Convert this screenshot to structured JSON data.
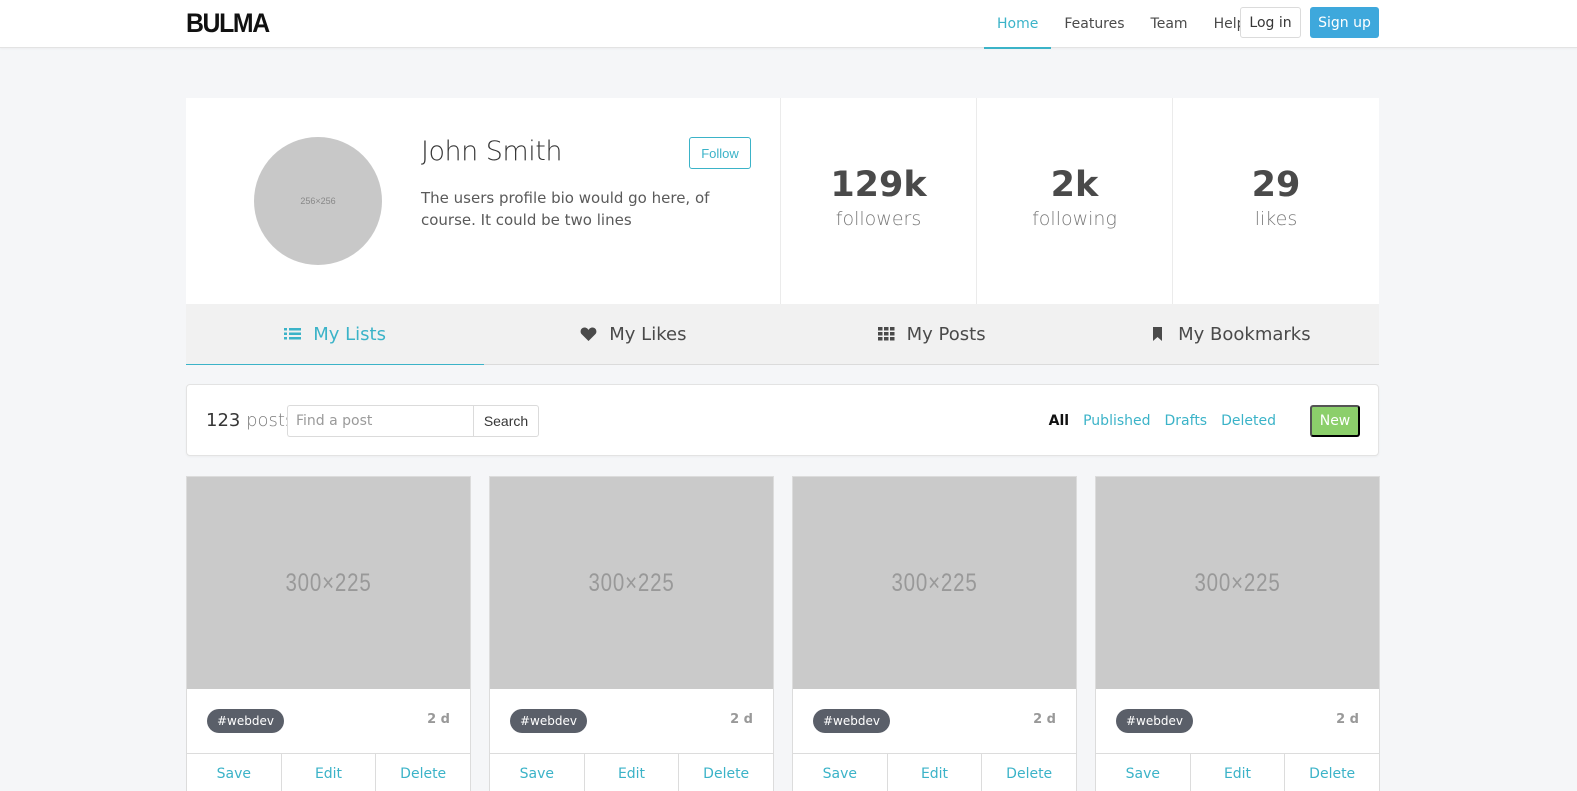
{
  "navbar": {
    "logo": "BULMA",
    "links": [
      "Home",
      "Features",
      "Team",
      "Help"
    ],
    "active_link": "Home",
    "login_label": "Log in",
    "signup_label": "Sign up"
  },
  "profile": {
    "avatar_placeholder": "256×256",
    "name": "John Smith",
    "follow_label": "Follow",
    "bio": "The users profile bio would go here, of course. It could be two lines",
    "stats": [
      {
        "value": "129k",
        "label": "followers"
      },
      {
        "value": "2k",
        "label": "following"
      },
      {
        "value": "29",
        "label": "likes"
      }
    ]
  },
  "tabs": [
    {
      "label": "My Lists",
      "icon": "list-icon",
      "active": true
    },
    {
      "label": "My Likes",
      "icon": "heart-icon",
      "active": false
    },
    {
      "label": "My Posts",
      "icon": "grid-icon",
      "active": false
    },
    {
      "label": "My Bookmarks",
      "icon": "bookmark-icon",
      "active": false
    }
  ],
  "toolbar": {
    "count": "123",
    "count_label": "posts",
    "search_placeholder": "Find a post",
    "search_label": "Search",
    "filters": [
      "All",
      "Published",
      "Drafts",
      "Deleted"
    ],
    "active_filter": "All",
    "new_label": "New"
  },
  "cards": [
    {
      "image": "300×225",
      "tag": "#webdev",
      "age": "2 d",
      "actions": [
        "Save",
        "Edit",
        "Delete"
      ]
    },
    {
      "image": "300×225",
      "tag": "#webdev",
      "age": "2 d",
      "actions": [
        "Save",
        "Edit",
        "Delete"
      ]
    },
    {
      "image": "300×225",
      "tag": "#webdev",
      "age": "2 d",
      "actions": [
        "Save",
        "Edit",
        "Delete"
      ]
    },
    {
      "image": "300×225",
      "tag": "#webdev",
      "age": "2 d",
      "actions": [
        "Save",
        "Edit",
        "Delete"
      ]
    }
  ],
  "colors": {
    "accent": "#3bb3c8",
    "signup": "#3ea8dc",
    "new": "#8ccf6b",
    "tag": "#5a5f69"
  }
}
